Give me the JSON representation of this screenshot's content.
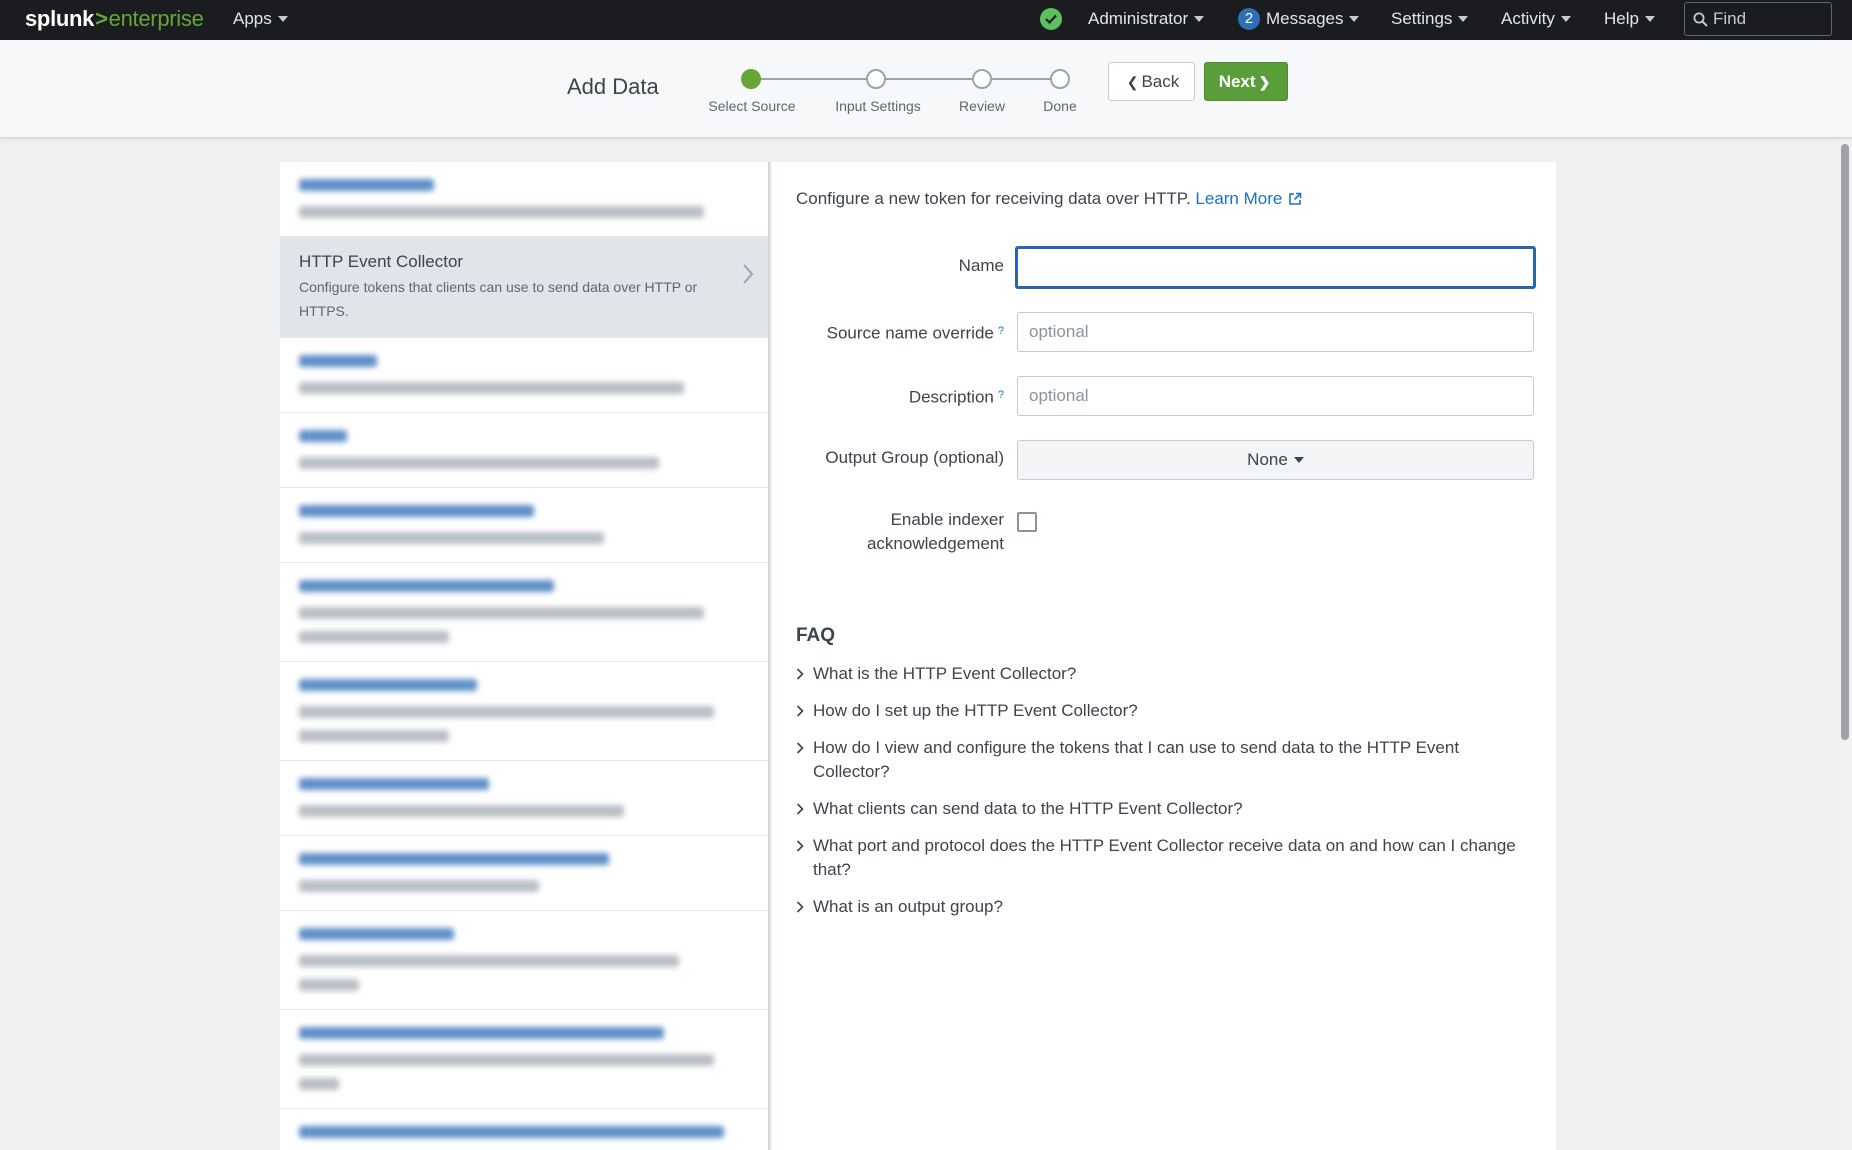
{
  "topbar": {
    "logo_brand": "splunk",
    "logo_gt": ">",
    "logo_product": "enterprise",
    "apps": "Apps",
    "health_icon": "check-circle-icon",
    "user": "Administrator",
    "messages_count": "2",
    "messages": "Messages",
    "settings": "Settings",
    "activity": "Activity",
    "help": "Help",
    "find_placeholder": "Find"
  },
  "header": {
    "title": "Add Data",
    "steps": [
      {
        "label": "Select Source",
        "state": "active"
      },
      {
        "label": "Input Settings",
        "state": "pending"
      },
      {
        "label": "Review",
        "state": "pending"
      },
      {
        "label": "Done",
        "state": "pending"
      }
    ],
    "back_label": "Back",
    "next_label": "Next"
  },
  "source_list": {
    "selected": {
      "title": "HTTP Event Collector",
      "description": "Configure tokens that clients can use to send data over HTTP or HTTPS."
    }
  },
  "form": {
    "intro": "Configure a new token for receiving data over HTTP.",
    "learn_more": "Learn More",
    "name_label": "Name",
    "name_value": "",
    "source_label": "Source name override",
    "source_placeholder": "optional",
    "description_label": "Description",
    "description_placeholder": "optional",
    "help_mark": "?",
    "output_group_label": "Output Group (optional)",
    "output_group_value": "None",
    "indexer_ack_label": "Enable indexer acknowledgement",
    "indexer_ack_checked": false
  },
  "faq": {
    "title": "FAQ",
    "items": [
      "What is the HTTP Event Collector?",
      "How do I set up the HTTP Event Collector?",
      "How do I view and configure the tokens that I can use to send data to the HTTP Event Collector?",
      "What clients can send data to the HTTP Event Collector?",
      "What port and protocol does the HTTP Event Collector receive data on and how can I change that?",
      "What is an output group?"
    ]
  },
  "colors": {
    "topbar_bg": "#1a1c20",
    "brand_green": "#65a637",
    "next_button": "#5a9e3b",
    "link_blue": "#1a73c5",
    "focus_blue": "#2a65ad"
  }
}
